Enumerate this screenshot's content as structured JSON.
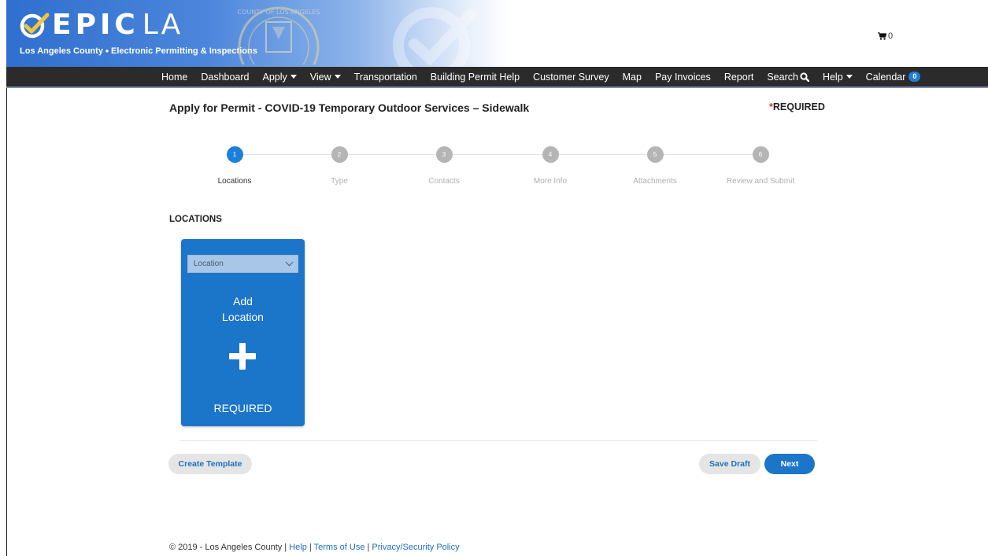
{
  "brand": {
    "logo_bold": "EPIC",
    "logo_thin": "LA",
    "subtitle": "Los Angeles County ⬩ Electronic Permitting & Inspections",
    "seal_text": "COUNTY OF LOS ANGELES"
  },
  "cart": {
    "count": "0"
  },
  "nav": {
    "items": [
      {
        "label": "Home"
      },
      {
        "label": "Dashboard"
      },
      {
        "label": "Apply"
      },
      {
        "label": "View"
      },
      {
        "label": "Transportation"
      },
      {
        "label": "Building Permit Help"
      },
      {
        "label": "Customer Survey"
      },
      {
        "label": "Map"
      },
      {
        "label": "Pay Invoices"
      },
      {
        "label": "Report"
      },
      {
        "label": "Search"
      },
      {
        "label": "Help"
      },
      {
        "label": "Calendar",
        "badge": "0"
      }
    ]
  },
  "page": {
    "title": "Apply for Permit - COVID-19 Temporary Outdoor Services – Sidewalk",
    "required_star": "*",
    "required_label": "REQUIRED"
  },
  "steps": [
    {
      "num": "1",
      "label": "Locations",
      "active": true
    },
    {
      "num": "2",
      "label": "Type"
    },
    {
      "num": "3",
      "label": "Contacts"
    },
    {
      "num": "4",
      "label": "More Info"
    },
    {
      "num": "5",
      "label": "Attachments"
    },
    {
      "num": "6",
      "label": "Review and Submit"
    }
  ],
  "locations": {
    "section_title": "LOCATIONS",
    "select_value": "Location",
    "add_line1": "Add",
    "add_line2": "Location",
    "required": "REQUIRED"
  },
  "buttons": {
    "create_template": "Create Template",
    "save_draft": "Save Draft",
    "next": "Next"
  },
  "footer": {
    "copyright": "© 2019 - Los Angeles County | ",
    "help": "Help",
    "sep": " | ",
    "terms": "Terms of Use",
    "privacy": "Privacy/Security Policy"
  },
  "colors": {
    "primary": "#1b75c9",
    "nav_bg": "#2b2b2b",
    "inactive_step": "#b5b5b5",
    "required_star": "#dd3333"
  }
}
